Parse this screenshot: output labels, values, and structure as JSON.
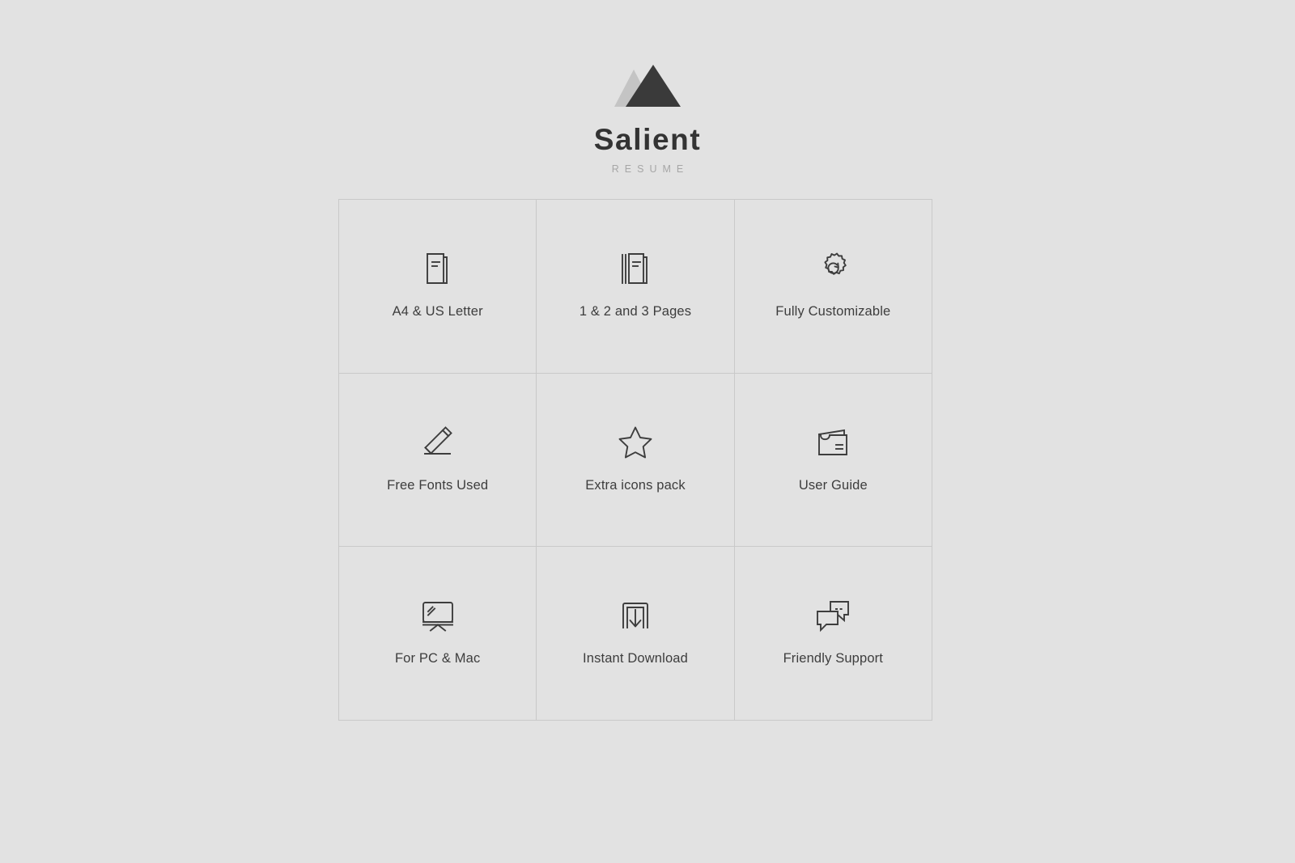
{
  "brand": {
    "title": "Salient",
    "subtitle": "RESUME",
    "logo_icon": "mountain-peaks-icon",
    "title_color": "#333333",
    "subtitle_color": "#a6a6a6",
    "logo_dark_color": "#3a3a3a",
    "logo_light_color": "#c4c4c4"
  },
  "theme": {
    "background": "#e2e2e2",
    "grid_line": "#c9c9c9",
    "icon_stroke": "#3d3d3d",
    "label_color": "#3d3d3d"
  },
  "features": [
    {
      "label": "A4 & US Letter",
      "icon": "single-document-icon"
    },
    {
      "label": "1 & 2 and 3 Pages",
      "icon": "stacked-pages-icon"
    },
    {
      "label": "Fully Customizable",
      "icon": "gear-icon"
    },
    {
      "label": "Free Fonts Used",
      "icon": "pencil-icon"
    },
    {
      "label": "Extra icons pack",
      "icon": "star-icon"
    },
    {
      "label": "User Guide",
      "icon": "folder-icon"
    },
    {
      "label": "For PC & Mac",
      "icon": "monitor-icon"
    },
    {
      "label": "Instant Download",
      "icon": "download-icon"
    },
    {
      "label": "Friendly Support",
      "icon": "chat-bubbles-icon"
    }
  ]
}
